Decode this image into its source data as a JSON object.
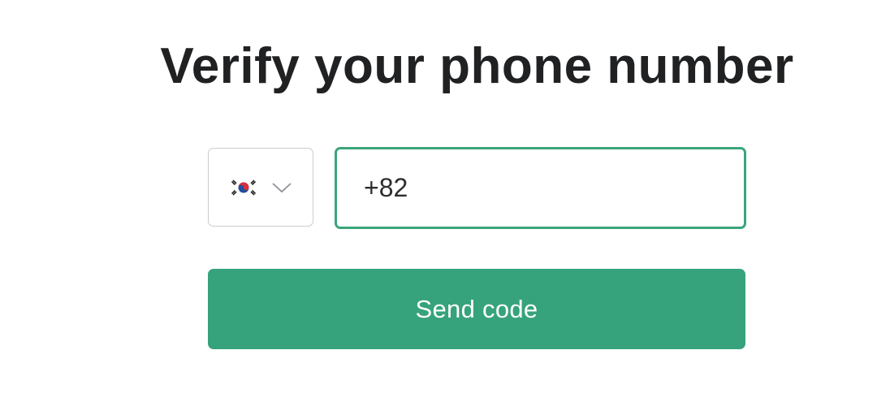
{
  "heading": "Verify your phone number",
  "country_selector": {
    "selected_flag": "south-korea-flag-icon",
    "dropdown_icon": "chevron-down-icon"
  },
  "phone_input": {
    "value": "+82"
  },
  "send_button": {
    "label": "Send code"
  },
  "colors": {
    "accent": "#36a37c",
    "input_focus_border": "#3ba57c",
    "title_text": "#202123",
    "select_border": "#c9ccd1"
  }
}
